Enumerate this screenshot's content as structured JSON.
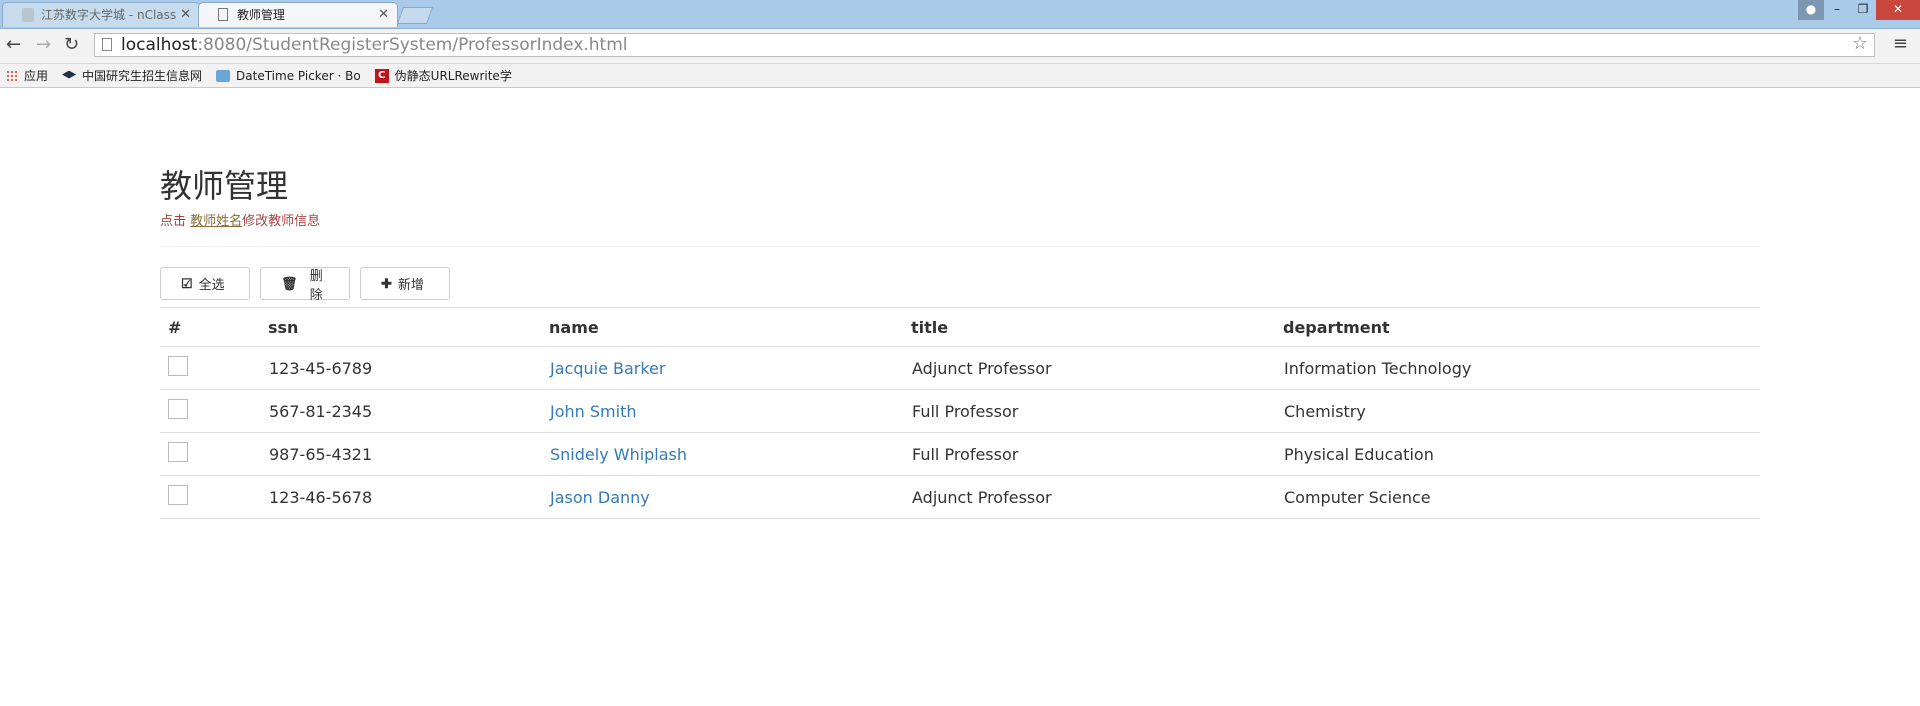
{
  "browser": {
    "tabs": [
      {
        "title": "江苏数字大学城 - nClass",
        "active": false
      },
      {
        "title": "教师管理",
        "active": true
      }
    ],
    "url_host": "localhost",
    "url_rest": ":8080/StudentRegisterSystem/ProfessorIndex.html",
    "bookmarks": [
      {
        "label": "应用",
        "icon": "apps-icon"
      },
      {
        "label": "中国研究生招生信息网",
        "icon": "graduation-cap-icon"
      },
      {
        "label": "DateTime Picker · Bo",
        "icon": "datetime-icon"
      },
      {
        "label": "伪静态URLRewrite学",
        "icon": "c-logo-icon"
      }
    ]
  },
  "page": {
    "title": "教师管理",
    "hint_prefix": "点击",
    "hint_link": "教师姓名",
    "hint_suffix": "修改教师信息"
  },
  "toolbar": {
    "select_all_label": "全选",
    "delete_label": "删除",
    "add_label": "新增"
  },
  "table": {
    "headers": [
      "#",
      "ssn",
      "name",
      "title",
      "department"
    ],
    "rows": [
      {
        "ssn": "123-45-6789",
        "name": "Jacquie Barker",
        "title": "Adjunct Professor",
        "department": "Information Technology"
      },
      {
        "ssn": "567-81-2345",
        "name": "John Smith",
        "title": "Full Professor",
        "department": "Chemistry"
      },
      {
        "ssn": "987-65-4321",
        "name": "Snidely Whiplash",
        "title": "Full Professor",
        "department": "Physical Education"
      },
      {
        "ssn": "123-46-5678",
        "name": "Jason Danny",
        "title": "Adjunct Professor",
        "department": "Computer Science"
      }
    ]
  },
  "colors": {
    "link": "#337ab7",
    "hint": "#a94442"
  }
}
